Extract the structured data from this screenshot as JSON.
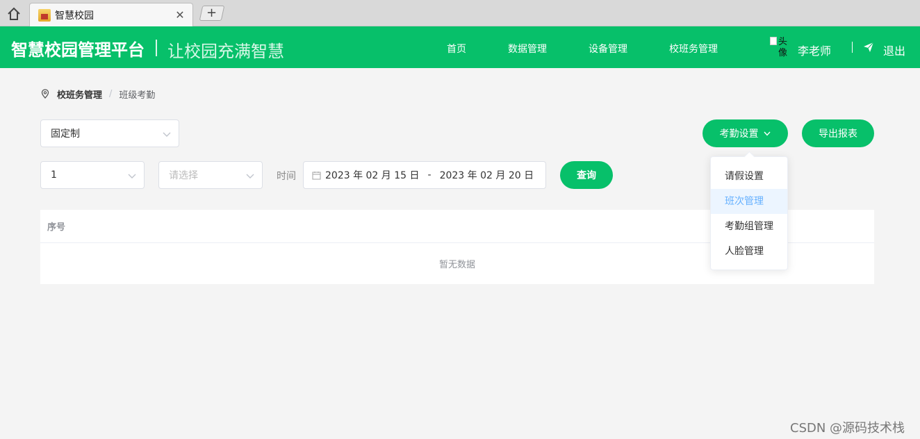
{
  "browser": {
    "tab_title": "智慧校园",
    "close_symbol": "✕",
    "new_tab_symbol": "+"
  },
  "header": {
    "brand": "智慧校园管理平台",
    "slogan": "让校园充满智慧",
    "nav": [
      "首页",
      "数据管理",
      "设备管理",
      "校班务管理"
    ],
    "avatar_alt": "头像",
    "user_name": "李老师",
    "logout": "退出",
    "bg_color": "#07c06a"
  },
  "breadcrumb": {
    "parent": "校班务管理",
    "separator": "/",
    "current": "班级考勤"
  },
  "filters": {
    "mode_value": "固定制",
    "class_value": "1",
    "group_placeholder": "请选择",
    "time_label": "时间",
    "date_start": "2023 年 02 月 15 日",
    "date_separator": "-",
    "date_end": "2023 年 02 月 20 日",
    "query_button": "查询"
  },
  "actions": {
    "attendance_settings": "考勤设置",
    "export_report": "导出报表"
  },
  "dropdown": {
    "items": [
      "请假设置",
      "班次管理",
      "考勤组管理",
      "人脸管理"
    ],
    "active_index": 1
  },
  "table": {
    "columns": [
      "序号"
    ],
    "empty_text": "暂无数据"
  },
  "watermark": "CSDN @源码技术栈"
}
